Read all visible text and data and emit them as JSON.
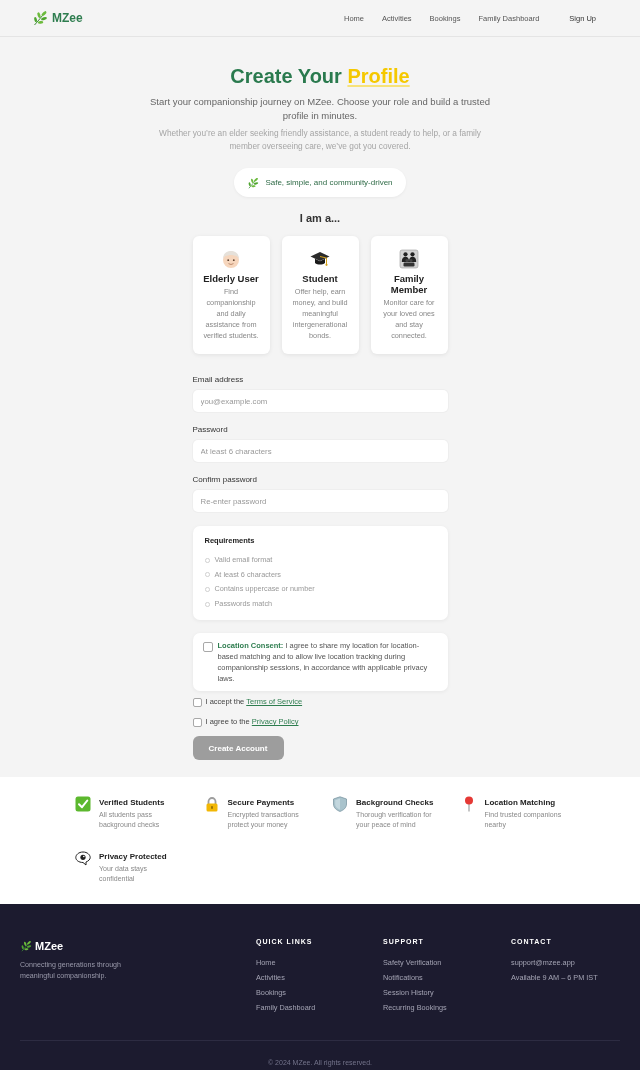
{
  "nav": {
    "brand": "MZee",
    "links": [
      {
        "label": "Home"
      },
      {
        "label": "Activities"
      },
      {
        "label": "Bookings"
      },
      {
        "label": "Family Dashboard"
      }
    ],
    "action": "Sign Up"
  },
  "hero": {
    "title": "Create Your **Profile**",
    "lead": "Start your companionship journey on MZee. Choose your role and build a trusted profile in minutes.",
    "note": "Whether you’re an elder seeking friendly assistance, a student ready to help, or a family member overseeing care, we’ve got you covered.",
    "badge": "Safe, simple, and community-driven"
  },
  "role_prompt": "I am a...",
  "roles": [
    {
      "title": "Elderly User",
      "description": "Find companionship and daily assistance from verified students.",
      "selected": false
    },
    {
      "title": "Student",
      "description": "Offer help, earn money, and build meaningful intergenerational bonds.",
      "selected": false
    },
    {
      "title": "Family Member",
      "description": "Monitor care for your loved ones and stay connected.",
      "selected": false
    }
  ],
  "form": {
    "fields": [
      {
        "label": "Email address",
        "placeholder": "you@example.com"
      },
      {
        "label": "Password",
        "placeholder": "At least 6 characters"
      },
      {
        "label": "Confirm password",
        "placeholder": "Re-enter password"
      }
    ],
    "requirements": {
      "title": "Requirements",
      "items": [
        {
          "text": "Valid email format",
          "met": false
        },
        {
          "text": "At least 6 characters",
          "met": false
        },
        {
          "text": "Contains uppercase or number",
          "met": false
        },
        {
          "text": "Passwords match",
          "met": false
        }
      ]
    },
    "consent": {
      "text": "**Location Consent:** I agree to share my location for location-based matching and to allow live location tracking during companionship sessions, in accordance with applicable privacy laws.",
      "checked": false
    },
    "agreements": [
      {
        "text": "I accept the",
        "link": "Terms of Service",
        "checked": false
      },
      {
        "text": "I agree to the",
        "link": "Privacy Policy",
        "checked": false
      }
    ],
    "submit": {
      "label": "Create Account",
      "disabled": true
    }
  },
  "features": [
    {
      "title": "Verified Students",
      "description": "All students pass background checks"
    },
    {
      "title": "Secure Payments",
      "description": "Encrypted transactions protect your money"
    },
    {
      "title": "Background Checks",
      "description": "Thorough verification for your peace of mind"
    },
    {
      "title": "Location Matching",
      "description": "Find trusted companions nearby"
    },
    {
      "title": "Privacy Protected",
      "description": "Your data stays confidential"
    }
  ],
  "footer": {
    "brand": "MZee",
    "tagline": "Connecting generations through meaningful companionship.",
    "columns": [
      {
        "heading": "QUICK LINKS",
        "links": [
          "Home",
          "Activities",
          "Bookings",
          "Family Dashboard"
        ]
      },
      {
        "heading": "SUPPORT",
        "links": [
          "Safety Verification",
          "Notifications",
          "Session History",
          "Recurring Bookings"
        ]
      }
    ],
    "contact": {
      "heading": "CONTACT",
      "email": "support@mzee.app",
      "hours": "Available 9 AM – 6 PM IST"
    },
    "copyright": "© 2024 MZee. All rights reserved."
  }
}
